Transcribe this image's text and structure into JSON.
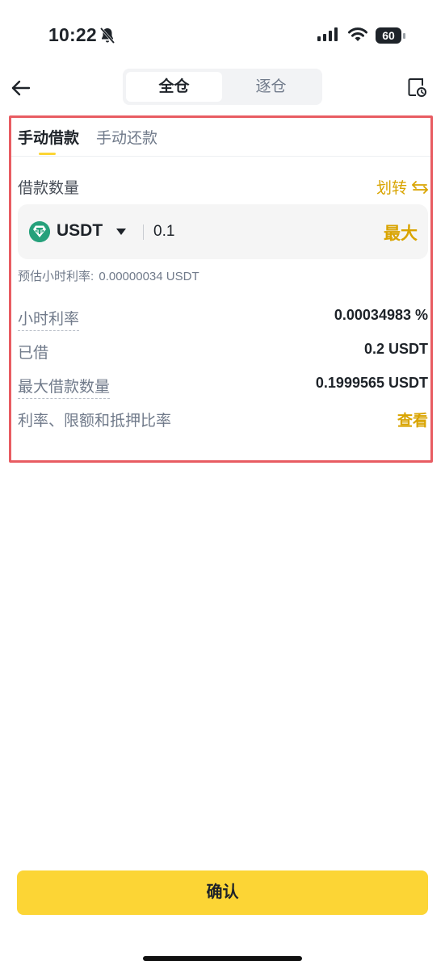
{
  "status_bar": {
    "time": "10:22",
    "battery": "60"
  },
  "nav": {
    "segments": {
      "active": "全仓",
      "inactive": "逐仓"
    }
  },
  "tabs": {
    "active": "手动借款",
    "inactive": "手动还款"
  },
  "borrow": {
    "label": "借款数量",
    "transfer_label": "划转",
    "coin": "USDT",
    "amount": "0.1",
    "max_label": "最大",
    "estimate_label": "预估小时利率",
    "estimate_value": "0.00000034 USDT"
  },
  "details": [
    {
      "key": "小时利率",
      "value": "0.00034983 %"
    },
    {
      "key": "已借",
      "value": "0.2 USDT"
    },
    {
      "key": "最大借款数量",
      "value": "0.1999565 USDT"
    },
    {
      "key": "利率、限额和抵押比率",
      "value": "查看"
    }
  ],
  "confirm_label": "确认",
  "colors": {
    "accent": "#fcd535",
    "accent_text": "#d9a400",
    "highlight_border": "#e85c62",
    "tether": "#26a17b"
  },
  "icons": [
    "bell-slash-icon",
    "signal-icon",
    "wifi-icon",
    "battery-icon",
    "back-arrow-icon",
    "history-icon",
    "swap-icon",
    "tether-logo-icon",
    "caret-down-icon"
  ]
}
